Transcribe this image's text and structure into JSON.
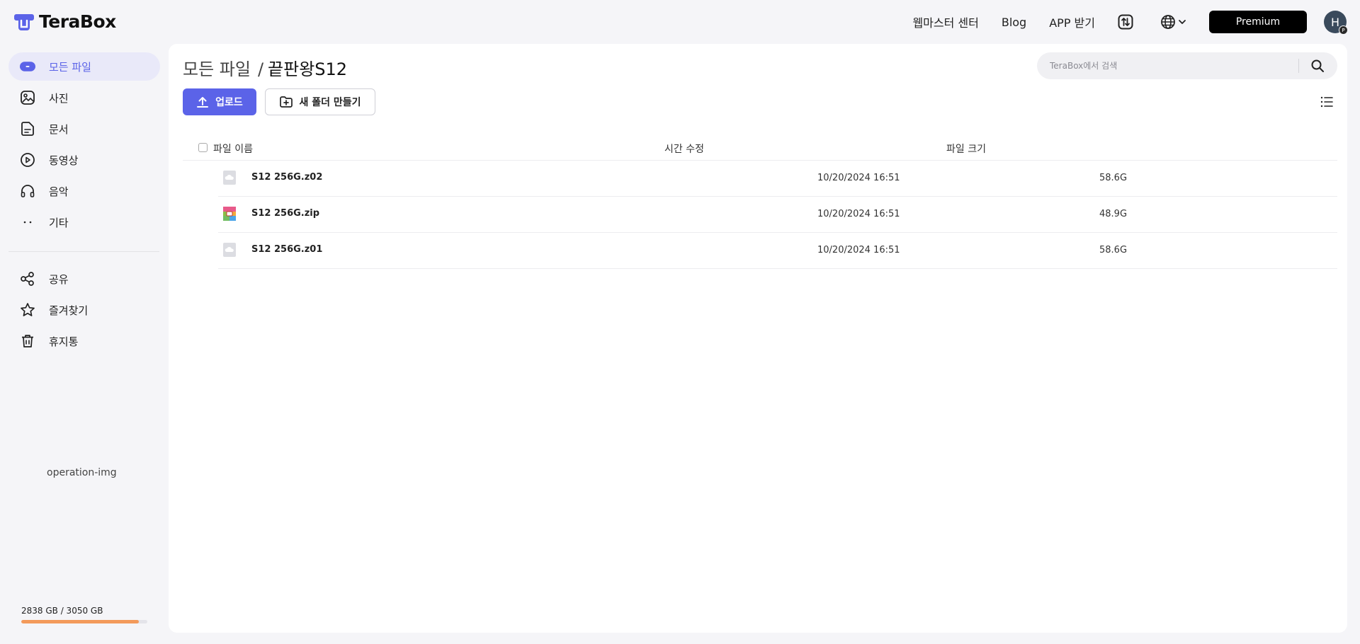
{
  "app": {
    "name": "TeraBox",
    "accent": "#5b63e8"
  },
  "topnav": {
    "webmaster": "웹마스터 센터",
    "blog": "Blog",
    "app": "APP 받기",
    "premium": "Premium",
    "avatar_initial": "H",
    "avatar_badge": "P"
  },
  "sidebar": {
    "items": [
      {
        "label": "모든 파일",
        "icon": "all-files-icon",
        "active": true
      },
      {
        "label": "사진",
        "icon": "photo-icon"
      },
      {
        "label": "문서",
        "icon": "document-icon"
      },
      {
        "label": "동영상",
        "icon": "video-icon"
      },
      {
        "label": "음악",
        "icon": "music-icon"
      },
      {
        "label": "기타",
        "icon": "more-icon"
      }
    ],
    "secondary": [
      {
        "label": "공유",
        "icon": "share-icon"
      },
      {
        "label": "즐겨찾기",
        "icon": "star-icon"
      },
      {
        "label": "휴지통",
        "icon": "trash-icon"
      }
    ],
    "operation_img_alt": "operation-img",
    "storage": {
      "text": "2838 GB / 3050 GB",
      "used_fraction": 0.93
    }
  },
  "main": {
    "breadcrumb": {
      "root": "모든 파일",
      "separator": "/",
      "current": "끝판왕S12"
    },
    "search": {
      "placeholder": "TeraBox에서 검색"
    },
    "upload_label": "업로드",
    "new_folder_label": "새 폴더 만들기",
    "columns": {
      "name": "파일 이름",
      "time": "시간 수정",
      "size": "파일 크기"
    },
    "files": [
      {
        "name": "S12 256G.z02",
        "time": "10/20/2024 16:51",
        "size": "58.6G",
        "type": "unknown"
      },
      {
        "name": "S12 256G.zip",
        "time": "10/20/2024 16:51",
        "size": "48.9G",
        "type": "zip"
      },
      {
        "name": "S12 256G.z01",
        "time": "10/20/2024 16:51",
        "size": "58.6G",
        "type": "unknown"
      }
    ]
  }
}
